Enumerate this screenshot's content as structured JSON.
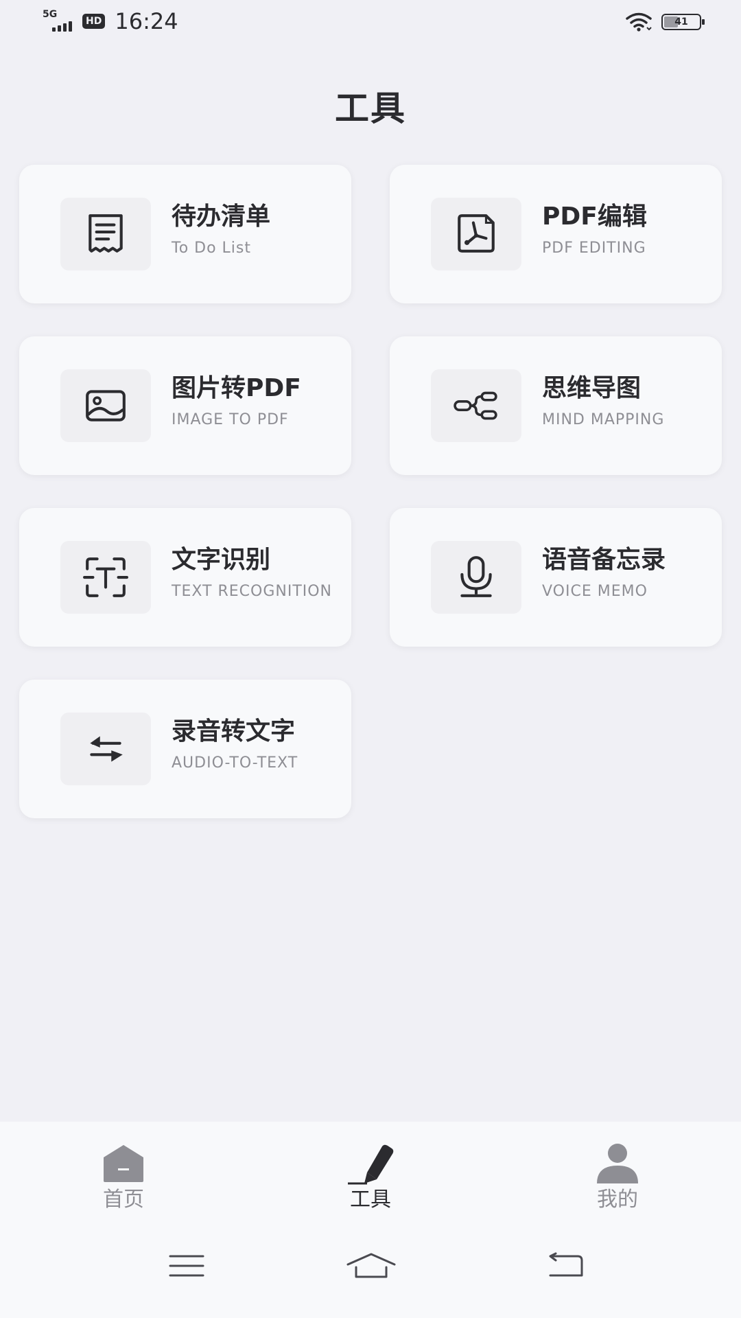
{
  "status_bar": {
    "network": "5G",
    "hd": "HD",
    "time": "16:24",
    "battery": "41",
    "battery_level": 0.41,
    "icons": [
      "signal-icon",
      "wifi-icon",
      "battery-icon"
    ]
  },
  "page": {
    "title": "工具"
  },
  "tools": [
    {
      "title": "待办清单",
      "subtitle": "To Do List",
      "icon": "receipt-list-icon"
    },
    {
      "title": "PDF编辑",
      "subtitle": "PDF EDITING",
      "icon": "pdf-icon"
    },
    {
      "title": "图片转PDF",
      "subtitle": "IMAGE TO PDF",
      "icon": "image-icon"
    },
    {
      "title": "思维导图",
      "subtitle": "MIND MAPPING",
      "icon": "mind-map-icon"
    },
    {
      "title": "文字识别",
      "subtitle": "TEXT RECOGNITION",
      "icon": "text-scan-icon"
    },
    {
      "title": "语音备忘录",
      "subtitle": "VOICE MEMO",
      "icon": "microphone-icon"
    },
    {
      "title": "录音转文字",
      "subtitle": "AUDIO-TO-TEXT",
      "icon": "swap-arrows-icon"
    }
  ],
  "bottom_nav": {
    "items": [
      {
        "label": "首页",
        "icon": "home-icon",
        "active": false
      },
      {
        "label": "工具",
        "icon": "pen-icon",
        "active": true
      },
      {
        "label": "我的",
        "icon": "user-icon",
        "active": false
      }
    ],
    "colors": {
      "active": "#2b2b2f",
      "inactive": "#8e8e94"
    }
  },
  "system_nav": {
    "icons": [
      "menu-icon",
      "home-outline-icon",
      "back-icon"
    ]
  }
}
